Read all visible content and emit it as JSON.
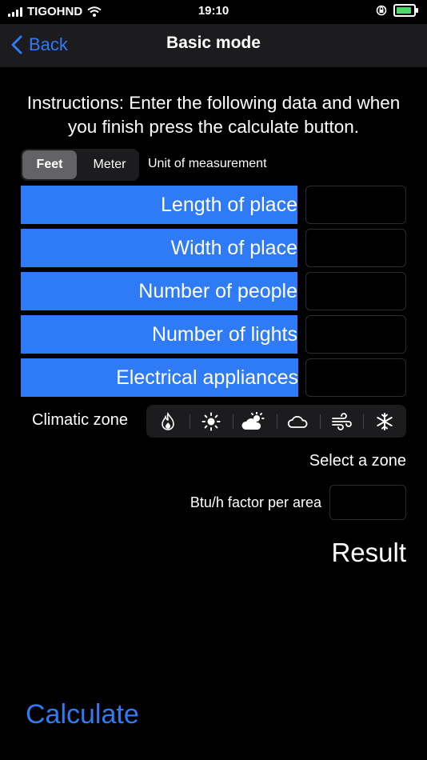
{
  "status_bar": {
    "carrier": "TIGOHND",
    "time": "19:10"
  },
  "nav": {
    "back_label": "Back",
    "title": "Basic mode"
  },
  "instructions": "Instructions: Enter the following data and when you finish press the calculate button.",
  "units": {
    "options": [
      "Feet",
      "Meter"
    ],
    "selected": "Feet",
    "label": "Unit of measurement"
  },
  "fields": [
    {
      "label": "Length of place",
      "value": ""
    },
    {
      "label": "Width of place",
      "value": ""
    },
    {
      "label": "Number of people",
      "value": ""
    },
    {
      "label": "Number of lights",
      "value": ""
    },
    {
      "label": "Electrical appliances",
      "value": ""
    }
  ],
  "climate": {
    "label": "Climatic zone",
    "zones": [
      "fire-icon",
      "sun-icon",
      "sun-cloud-icon",
      "cloud-icon",
      "wind-icon",
      "snowflake-icon"
    ],
    "select_text": "Select a zone"
  },
  "factor": {
    "label": "Btu/h factor per area",
    "value": ""
  },
  "result_label": "Result",
  "calculate_label": "Calculate",
  "colors": {
    "accent": "#2f7bf6",
    "background": "#000000",
    "panel": "#1c1c1e",
    "battery": "#4cd964"
  }
}
